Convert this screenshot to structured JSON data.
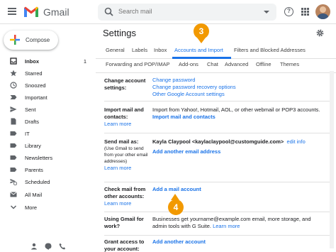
{
  "app": {
    "logo_text": "Gmail",
    "search_placeholder": "Search mail",
    "help_glyph": "?"
  },
  "sidebar": {
    "compose_label": "Compose",
    "items": [
      {
        "label": "Inbox",
        "count": "1",
        "icon": "inbox-icon",
        "bold": true
      },
      {
        "label": "Starred",
        "count": "",
        "icon": "star-icon"
      },
      {
        "label": "Snoozed",
        "count": "",
        "icon": "clock-icon"
      },
      {
        "label": "Important",
        "count": "",
        "icon": "important-icon"
      },
      {
        "label": "Sent",
        "count": "",
        "icon": "send-icon"
      },
      {
        "label": "Drafts",
        "count": "",
        "icon": "draft-icon"
      },
      {
        "label": "IT",
        "count": "",
        "icon": "label-icon"
      },
      {
        "label": "Library",
        "count": "",
        "icon": "label-icon"
      },
      {
        "label": "Newsletters",
        "count": "",
        "icon": "label-icon"
      },
      {
        "label": "Parents",
        "count": "",
        "icon": "label-icon"
      },
      {
        "label": "Scheduled",
        "count": "",
        "icon": "scheduled-icon"
      },
      {
        "label": "All Mail",
        "count": "",
        "icon": "all-mail-icon"
      },
      {
        "label": "More",
        "count": "",
        "icon": "chevron-down-icon"
      }
    ]
  },
  "settings": {
    "title": "Settings",
    "tabs_row1": [
      "General",
      "Labels",
      "Inbox",
      "Accounts and Import",
      "Filters and Blocked Addresses"
    ],
    "tabs_row2": [
      "Forwarding and POP/IMAP",
      "Add-ons",
      "Chat",
      "Advanced",
      "Offline",
      "Themes"
    ],
    "active_tab": "Accounts and Import",
    "rows": {
      "change_account": {
        "label": "Change account settings:",
        "links": [
          "Change password",
          "Change password recovery options",
          "Other Google Account settings"
        ]
      },
      "import": {
        "label": "Import mail and contacts:",
        "learn_more": "Learn more",
        "text": "Import from Yahoo!, Hotmail, AOL, or other webmail or POP3 accounts.",
        "action": "Import mail and contacts"
      },
      "send_as": {
        "label": "Send mail as:",
        "sub": "(Use Gmail to send from your other email addresses)",
        "learn_more": "Learn more",
        "account": "Kayla Claypool <kaylaclaypool@customguide.com>",
        "edit": "edit info",
        "action": "Add another email address"
      },
      "check_mail": {
        "label": "Check mail from other accounts:",
        "learn_more": "Learn more",
        "action": "Add a mail account"
      },
      "work": {
        "label": "Using Gmail for work?",
        "text1": "Businesses get yourname@example.com email, more storage, and",
        "text2": "admin tools with G Suite.",
        "learn_more": "Learn more"
      },
      "grant": {
        "label": "Grant access to your account:",
        "action": "Add another account"
      }
    }
  },
  "callouts": [
    "3",
    "4"
  ],
  "colors": {
    "accent": "#1a73e8",
    "callout": "#f29900"
  }
}
